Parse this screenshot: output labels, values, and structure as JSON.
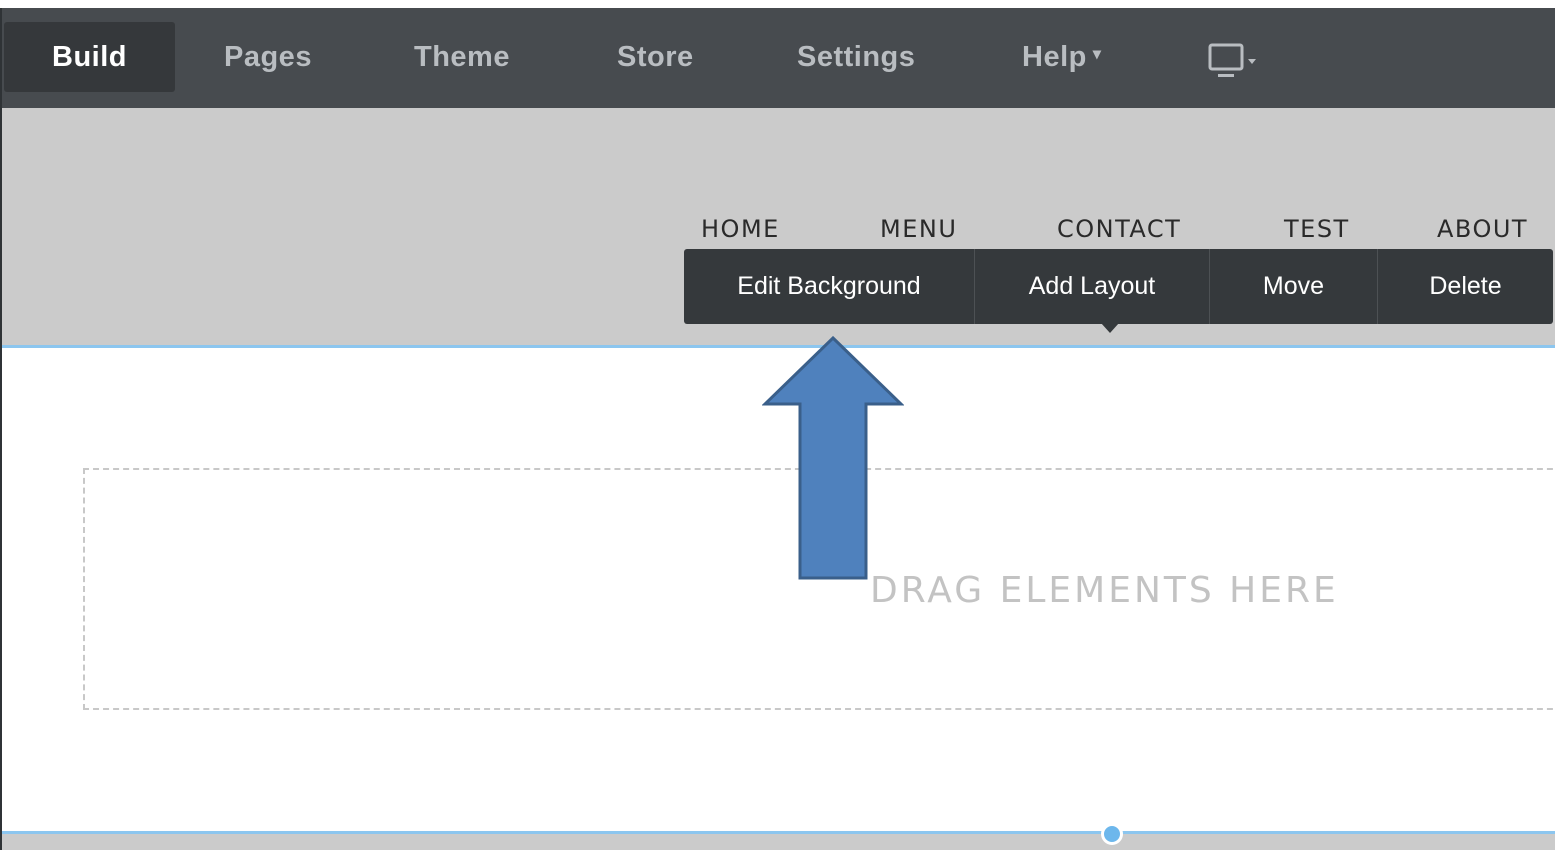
{
  "toolbar": {
    "tabs": [
      {
        "label": "Build",
        "active": true
      },
      {
        "label": "Pages"
      },
      {
        "label": "Theme"
      },
      {
        "label": "Store"
      },
      {
        "label": "Settings"
      },
      {
        "label": "Help"
      }
    ],
    "help_caret": "▾",
    "device_icon": "monitor-icon",
    "device_caret": "▾"
  },
  "site_nav": {
    "links": [
      "HOME",
      "MENU",
      "CONTACT",
      "TEST",
      "ABOUT"
    ]
  },
  "section_toolbar": {
    "edit_background": "Edit Background",
    "add_layout": "Add Layout",
    "move": "Move",
    "delete": "Delete"
  },
  "section": {
    "drop_placeholder": "DRAG ELEMENTS HERE"
  },
  "colors": {
    "toolbar_bg": "#474b4f",
    "header_bg": "#cbcbcb",
    "section_toolbar_bg": "#35393c",
    "section_border": "#8cc6ef",
    "arrow_fill": "#4f81bd",
    "arrow_stroke": "#3a5f8a"
  }
}
